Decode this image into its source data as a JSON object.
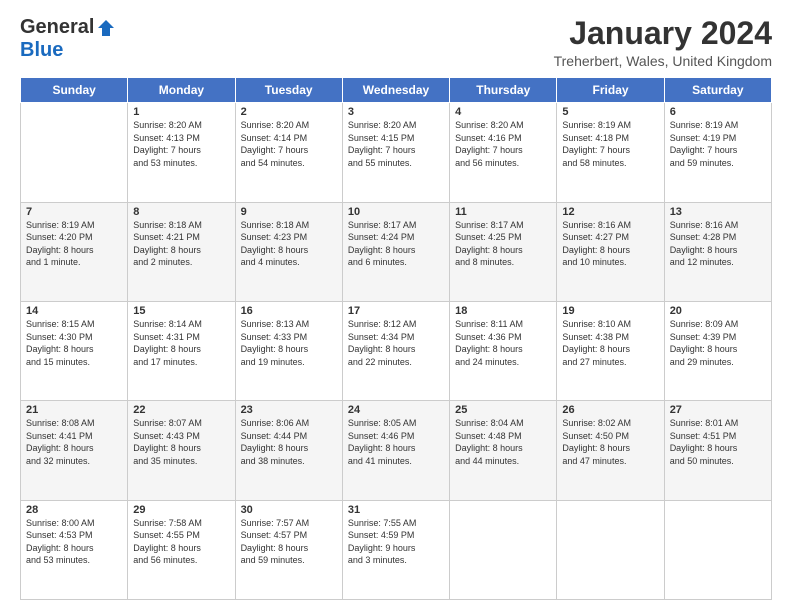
{
  "header": {
    "logo_general": "General",
    "logo_blue": "Blue",
    "month_title": "January 2024",
    "location": "Treherbert, Wales, United Kingdom"
  },
  "days_of_week": [
    "Sunday",
    "Monday",
    "Tuesday",
    "Wednesday",
    "Thursday",
    "Friday",
    "Saturday"
  ],
  "weeks": [
    [
      {
        "day": "",
        "info": ""
      },
      {
        "day": "1",
        "info": "Sunrise: 8:20 AM\nSunset: 4:13 PM\nDaylight: 7 hours\nand 53 minutes."
      },
      {
        "day": "2",
        "info": "Sunrise: 8:20 AM\nSunset: 4:14 PM\nDaylight: 7 hours\nand 54 minutes."
      },
      {
        "day": "3",
        "info": "Sunrise: 8:20 AM\nSunset: 4:15 PM\nDaylight: 7 hours\nand 55 minutes."
      },
      {
        "day": "4",
        "info": "Sunrise: 8:20 AM\nSunset: 4:16 PM\nDaylight: 7 hours\nand 56 minutes."
      },
      {
        "day": "5",
        "info": "Sunrise: 8:19 AM\nSunset: 4:18 PM\nDaylight: 7 hours\nand 58 minutes."
      },
      {
        "day": "6",
        "info": "Sunrise: 8:19 AM\nSunset: 4:19 PM\nDaylight: 7 hours\nand 59 minutes."
      }
    ],
    [
      {
        "day": "7",
        "info": "Sunrise: 8:19 AM\nSunset: 4:20 PM\nDaylight: 8 hours\nand 1 minute."
      },
      {
        "day": "8",
        "info": "Sunrise: 8:18 AM\nSunset: 4:21 PM\nDaylight: 8 hours\nand 2 minutes."
      },
      {
        "day": "9",
        "info": "Sunrise: 8:18 AM\nSunset: 4:23 PM\nDaylight: 8 hours\nand 4 minutes."
      },
      {
        "day": "10",
        "info": "Sunrise: 8:17 AM\nSunset: 4:24 PM\nDaylight: 8 hours\nand 6 minutes."
      },
      {
        "day": "11",
        "info": "Sunrise: 8:17 AM\nSunset: 4:25 PM\nDaylight: 8 hours\nand 8 minutes."
      },
      {
        "day": "12",
        "info": "Sunrise: 8:16 AM\nSunset: 4:27 PM\nDaylight: 8 hours\nand 10 minutes."
      },
      {
        "day": "13",
        "info": "Sunrise: 8:16 AM\nSunset: 4:28 PM\nDaylight: 8 hours\nand 12 minutes."
      }
    ],
    [
      {
        "day": "14",
        "info": "Sunrise: 8:15 AM\nSunset: 4:30 PM\nDaylight: 8 hours\nand 15 minutes."
      },
      {
        "day": "15",
        "info": "Sunrise: 8:14 AM\nSunset: 4:31 PM\nDaylight: 8 hours\nand 17 minutes."
      },
      {
        "day": "16",
        "info": "Sunrise: 8:13 AM\nSunset: 4:33 PM\nDaylight: 8 hours\nand 19 minutes."
      },
      {
        "day": "17",
        "info": "Sunrise: 8:12 AM\nSunset: 4:34 PM\nDaylight: 8 hours\nand 22 minutes."
      },
      {
        "day": "18",
        "info": "Sunrise: 8:11 AM\nSunset: 4:36 PM\nDaylight: 8 hours\nand 24 minutes."
      },
      {
        "day": "19",
        "info": "Sunrise: 8:10 AM\nSunset: 4:38 PM\nDaylight: 8 hours\nand 27 minutes."
      },
      {
        "day": "20",
        "info": "Sunrise: 8:09 AM\nSunset: 4:39 PM\nDaylight: 8 hours\nand 29 minutes."
      }
    ],
    [
      {
        "day": "21",
        "info": "Sunrise: 8:08 AM\nSunset: 4:41 PM\nDaylight: 8 hours\nand 32 minutes."
      },
      {
        "day": "22",
        "info": "Sunrise: 8:07 AM\nSunset: 4:43 PM\nDaylight: 8 hours\nand 35 minutes."
      },
      {
        "day": "23",
        "info": "Sunrise: 8:06 AM\nSunset: 4:44 PM\nDaylight: 8 hours\nand 38 minutes."
      },
      {
        "day": "24",
        "info": "Sunrise: 8:05 AM\nSunset: 4:46 PM\nDaylight: 8 hours\nand 41 minutes."
      },
      {
        "day": "25",
        "info": "Sunrise: 8:04 AM\nSunset: 4:48 PM\nDaylight: 8 hours\nand 44 minutes."
      },
      {
        "day": "26",
        "info": "Sunrise: 8:02 AM\nSunset: 4:50 PM\nDaylight: 8 hours\nand 47 minutes."
      },
      {
        "day": "27",
        "info": "Sunrise: 8:01 AM\nSunset: 4:51 PM\nDaylight: 8 hours\nand 50 minutes."
      }
    ],
    [
      {
        "day": "28",
        "info": "Sunrise: 8:00 AM\nSunset: 4:53 PM\nDaylight: 8 hours\nand 53 minutes."
      },
      {
        "day": "29",
        "info": "Sunrise: 7:58 AM\nSunset: 4:55 PM\nDaylight: 8 hours\nand 56 minutes."
      },
      {
        "day": "30",
        "info": "Sunrise: 7:57 AM\nSunset: 4:57 PM\nDaylight: 8 hours\nand 59 minutes."
      },
      {
        "day": "31",
        "info": "Sunrise: 7:55 AM\nSunset: 4:59 PM\nDaylight: 9 hours\nand 3 minutes."
      },
      {
        "day": "",
        "info": ""
      },
      {
        "day": "",
        "info": ""
      },
      {
        "day": "",
        "info": ""
      }
    ]
  ]
}
